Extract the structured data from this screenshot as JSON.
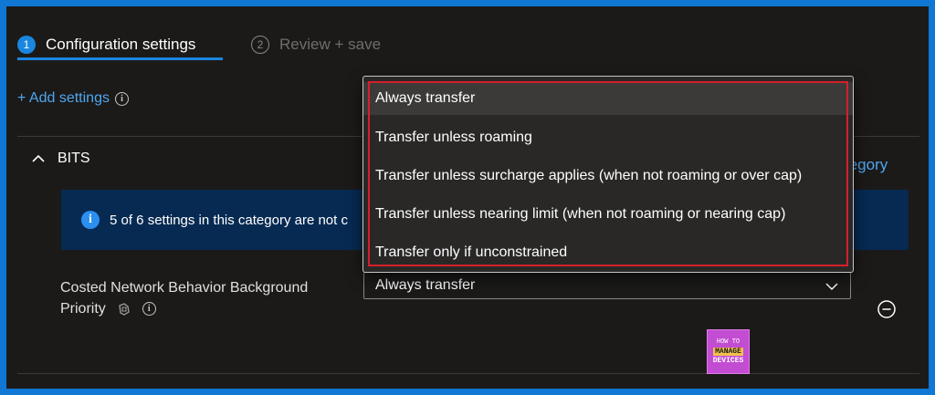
{
  "header": {
    "tabs": [
      {
        "number": "1",
        "label": "Configuration settings",
        "active": true
      },
      {
        "number": "2",
        "label": "Review + save",
        "active": false
      }
    ]
  },
  "toolbar": {
    "add_settings_label": "+ Add settings",
    "info_icon": "i"
  },
  "category": {
    "name": "BITS",
    "remove_label": "tegory"
  },
  "banner": {
    "info_icon": "i",
    "text": "5 of 6 settings in this category are not c"
  },
  "setting": {
    "label_line1": "Costed Network Behavior Background",
    "label_line2": "Priority",
    "info_icon": "i",
    "selected_value": "Always transfer"
  },
  "dropdown": {
    "options": [
      "Always transfer",
      "Transfer unless roaming",
      "Transfer unless surcharge applies (when not roaming or over cap)",
      "Transfer unless nearing limit (when not roaming or nearing cap)",
      "Transfer only if unconstrained"
    ],
    "selected_index": 0
  },
  "watermark": {
    "line1": "HOW TO",
    "line2": "MANAGE",
    "line3": "DEVICES"
  },
  "colors": {
    "frame": "#1078d4",
    "background": "#1b1a19",
    "accent": "#1a86e0",
    "link": "#4fa6f0",
    "banner": "#072a52",
    "highlight_border": "#d61f2b"
  }
}
